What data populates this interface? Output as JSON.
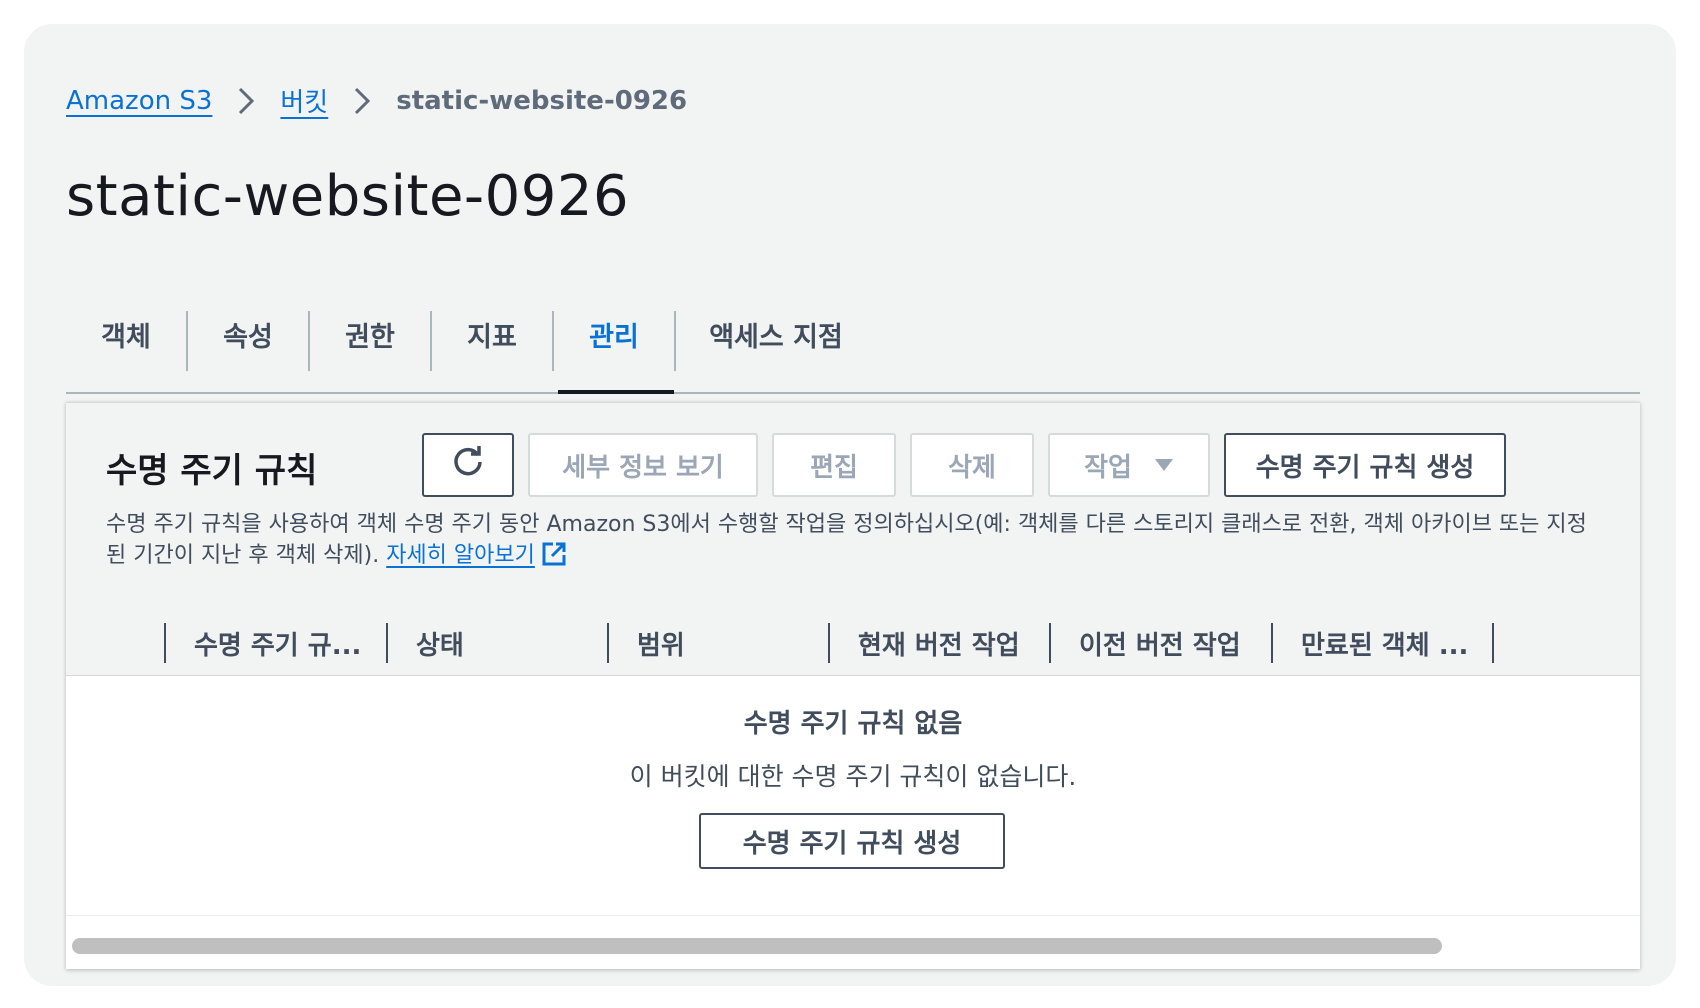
{
  "breadcrumb": {
    "items": [
      "Amazon S3",
      "버킷"
    ],
    "current": "static-website-0926"
  },
  "page": {
    "title": "static-website-0926"
  },
  "tabs": [
    {
      "label": "객체"
    },
    {
      "label": "속성"
    },
    {
      "label": "권한"
    },
    {
      "label": "지표"
    },
    {
      "label": "관리",
      "active": true
    },
    {
      "label": "액세스 지점"
    }
  ],
  "lifecycle": {
    "title": "수명 주기 규칙",
    "buttons": {
      "refresh_icon": "refresh-icon",
      "view_details": "세부 정보 보기",
      "edit": "편집",
      "delete": "삭제",
      "actions": "작업",
      "create": "수명 주기 규칙 생성"
    },
    "description": "수명 주기 규칙을 사용하여 객체 수명 주기 동안 Amazon S3에서 수행할 작업을 정의하십시오(예: 객체를 다른 스토리지 클래스로 전환, 객체 아카이브 또는 지정된 기간이 지난 후 객체 삭제).",
    "learn_more": "자세히 알아보기",
    "columns": [
      "수명 주기 규...",
      "상태",
      "범위",
      "현재 버전 작업",
      "이전 버전 작업",
      "만료된 객체 ..."
    ],
    "empty": {
      "title": "수명 주기 규칙 없음",
      "description": "이 버킷에 대한 수명 주기 규칙이 없습니다.",
      "button": "수명 주기 규칙 생성"
    }
  },
  "colors": {
    "link": "#0972d3",
    "text": "#16191f",
    "muted": "#414d5c",
    "disabled": "#9ba7b6",
    "background": "#f2f3f3"
  }
}
